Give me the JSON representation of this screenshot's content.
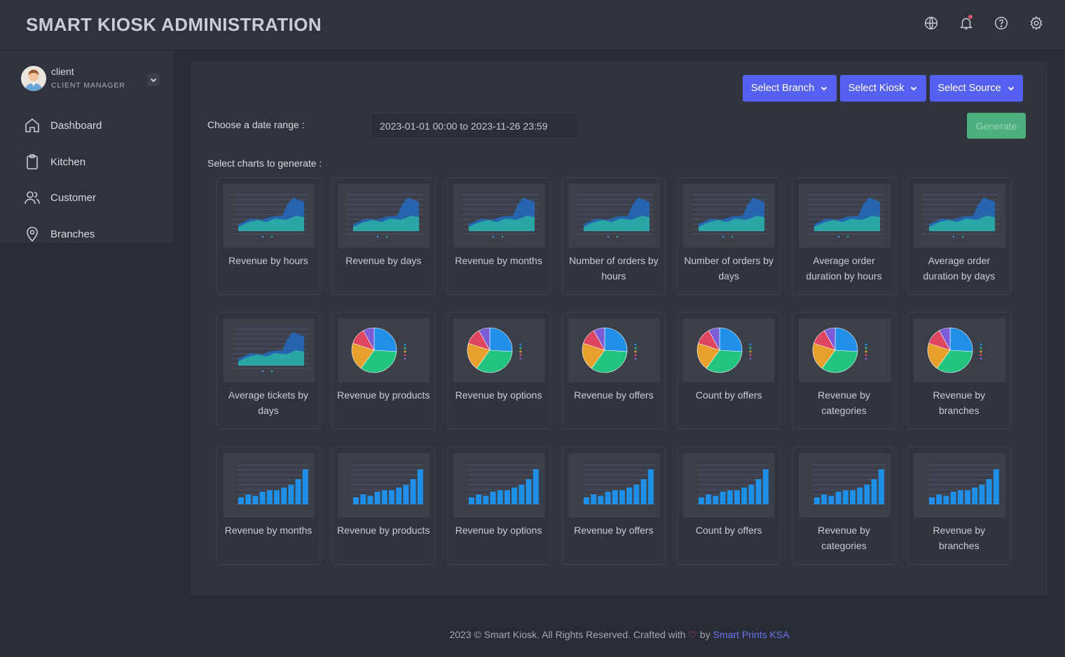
{
  "app": {
    "title": "SMART KIOSK ADMINISTRATION"
  },
  "topbar": {
    "icons": [
      "globe-icon",
      "bell-icon",
      "help-icon",
      "gear-icon"
    ]
  },
  "user": {
    "name": "client",
    "role": "CLIENT MANAGER"
  },
  "sidebar": {
    "items": [
      {
        "label": "Dashboard",
        "icon": "home-icon"
      },
      {
        "label": "Kitchen",
        "icon": "clipboard-icon"
      },
      {
        "label": "Customer",
        "icon": "users-icon"
      },
      {
        "label": "Branches",
        "icon": "map-pin-icon"
      }
    ]
  },
  "filters": {
    "branch_label": "Select Branch",
    "kiosk_label": "Select Kiosk",
    "source_label": "Select Source",
    "date_range_label": "Choose a date range :",
    "date_range_value": "2023-01-01 00:00 to 2023-11-26 23:59",
    "generate_label": "Generate",
    "select_charts_label": "Select charts to generate :"
  },
  "charts": [
    {
      "label": "Revenue by hours",
      "kind": "area"
    },
    {
      "label": "Revenue by days",
      "kind": "area"
    },
    {
      "label": "Revenue by months",
      "kind": "area"
    },
    {
      "label": "Number of orders by hours",
      "kind": "area"
    },
    {
      "label": "Number of orders by days",
      "kind": "area"
    },
    {
      "label": "Average order duration by hours",
      "kind": "area"
    },
    {
      "label": "Average order duration by days",
      "kind": "area"
    },
    {
      "label": "Average tickets by days",
      "kind": "area"
    },
    {
      "label": "Revenue by products",
      "kind": "pie"
    },
    {
      "label": "Revenue by options",
      "kind": "pie"
    },
    {
      "label": "Revenue by offers",
      "kind": "pie"
    },
    {
      "label": "Count by offers",
      "kind": "pie"
    },
    {
      "label": "Revenue by categories",
      "kind": "pie"
    },
    {
      "label": "Revenue by branches",
      "kind": "pie"
    },
    {
      "label": "Revenue by months",
      "kind": "bar"
    },
    {
      "label": "Revenue by products",
      "kind": "bar"
    },
    {
      "label": "Revenue by options",
      "kind": "bar"
    },
    {
      "label": "Revenue by offers",
      "kind": "bar"
    },
    {
      "label": "Count by offers",
      "kind": "bar"
    },
    {
      "label": "Revenue by categories",
      "kind": "bar"
    },
    {
      "label": "Revenue by branches",
      "kind": "bar"
    }
  ],
  "footer": {
    "text": "2023 © Smart Kiosk. All Rights Reserved. Crafted with",
    "by": "by",
    "brand": "Smart Prints KSA"
  },
  "colors": {
    "accent": "#5561f2",
    "generate": "#4caf7d",
    "pie": [
      "#1f8fe8",
      "#20c47f",
      "#e8a02c",
      "#e0455f",
      "#7b5cd6"
    ],
    "bar": "#1f8fe8",
    "area_front": "#2ab2a4",
    "area_back": "#1c74d9"
  }
}
